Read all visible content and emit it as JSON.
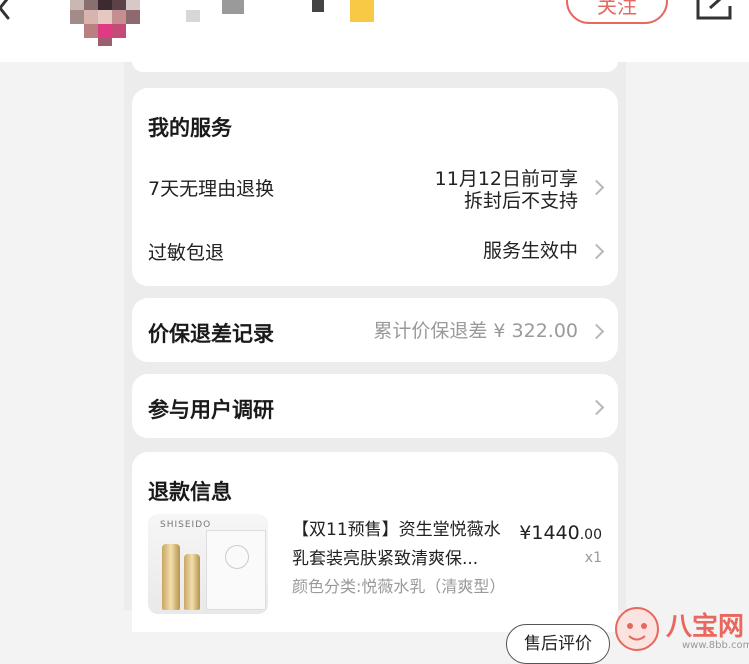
{
  "header": {
    "follow_label": "关注",
    "icons": {
      "back": "back-arrow-icon",
      "share": "share-icon"
    }
  },
  "services": {
    "title": "我的服务",
    "rows": [
      {
        "label": "7天无理由退换",
        "value_line1": "11月12日前可享",
        "value_line2": "拆封后不支持"
      },
      {
        "label": "过敏包退",
        "value": "服务生效中"
      }
    ]
  },
  "price_protection": {
    "label": "价保退差记录",
    "value": "累计价保退差 ¥ 322.00"
  },
  "survey": {
    "label": "参与用户调研"
  },
  "refund": {
    "title": "退款信息",
    "product": {
      "brand": "SHISEIDO",
      "title": "【双11预售】资生堂悦薇水乳套装亮肤紧致清爽保...",
      "spec": "颜色分类:悦薇水乳（清爽型）",
      "price_main": "¥1440",
      "price_decimal": ".00",
      "qty": "x1"
    }
  },
  "footer": {
    "after_sale_label": "售后评价"
  },
  "watermark": {
    "text": "八宝网",
    "url": "www.8bb.com"
  },
  "colors": {
    "accent": "#e8675e",
    "muted": "#9a9a9a",
    "background": "#f3f3f3"
  }
}
